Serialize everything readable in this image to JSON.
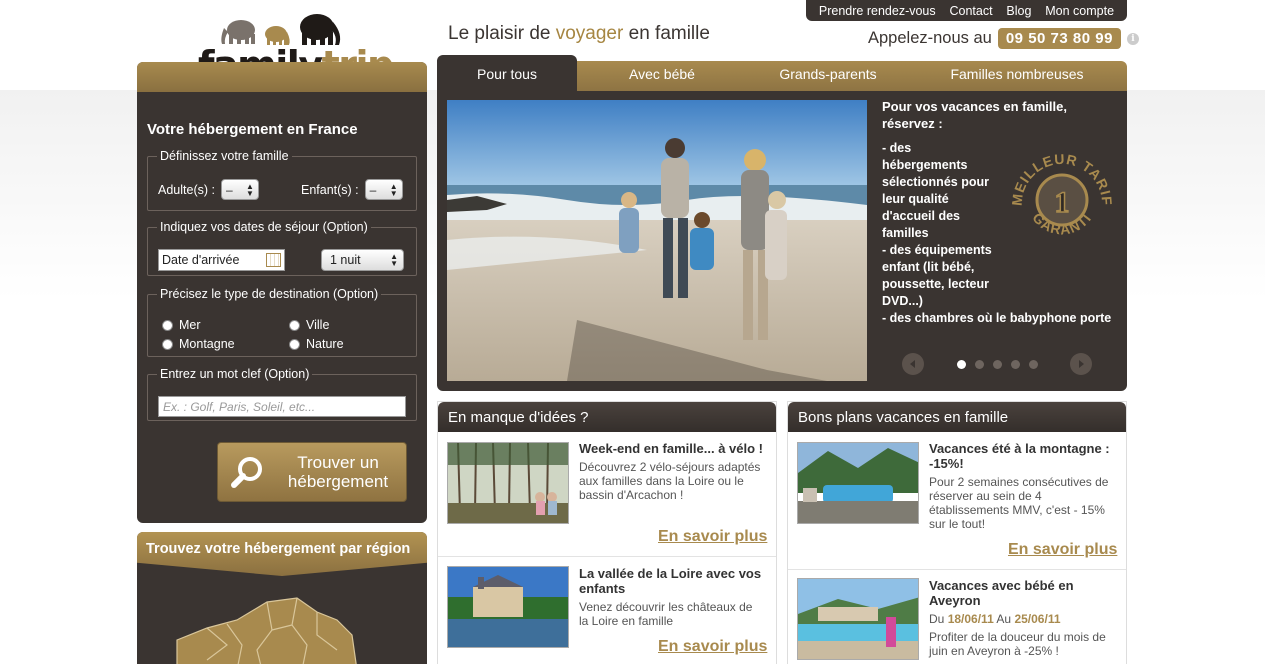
{
  "topnav": [
    "Prendre rendez-vous",
    "Contact",
    "Blog",
    "Mon compte"
  ],
  "logo": {
    "part1": "family",
    "part2": "trip"
  },
  "tagline": {
    "pre": "Le plaisir de ",
    "highlight": "voyager",
    "post": " en famille"
  },
  "phone": {
    "label": "Appelez-nous au",
    "number": "09 50 73 80 99",
    "info_icon": "info-icon"
  },
  "search": {
    "title": "Votre hébergement en France",
    "family_legend": "Définissez votre famille",
    "adults_label": "Adulte(s) :",
    "adults_value": "–",
    "children_label": "Enfant(s) :",
    "children_value": "–",
    "dates_legend": "Indiquez vos dates de séjour (Option)",
    "arrival_placeholder": "Date d'arrivée",
    "nights_value": "1 nuit",
    "type_legend": "Précisez le type de destination (Option)",
    "types": [
      "Mer",
      "Ville",
      "Montagne",
      "Nature"
    ],
    "keyword_legend": "Entrez un mot clef (Option)",
    "keyword_placeholder": "Ex. : Golf, Paris, Soleil, etc...",
    "button_line1": "Trouver un",
    "button_line2": "hébergement"
  },
  "region": {
    "title": "Trouvez votre hébergement par région"
  },
  "tabs": [
    "Pour tous",
    "Avec bébé",
    "Grands-parents",
    "Familles nombreuses"
  ],
  "slider": {
    "heading": "Pour vos vacances en famille, réservez :",
    "bullets": [
      "- des hébergements sélectionnés pour leur qualité d'accueil des familles",
      "- des équipements enfant (lit bébé, poussette, lecteur DVD...)",
      "- des chambres où le babyphone porte"
    ],
    "badge_top": "MEILLEUR TARIF",
    "badge_num": "1",
    "badge_bottom": "GARANTI",
    "dots": 5,
    "active_dot": 0
  },
  "ideas": {
    "title": "En manque d'idées ?",
    "items": [
      {
        "title": "Week-end en famille... à vélo !",
        "desc": "Découvrez 2 vélo-séjours adaptés aux familles dans la Loire ou le bassin d'Arcachon !",
        "more": "En savoir plus"
      },
      {
        "title": "La vallée de la Loire avec vos enfants",
        "desc": "Venez découvrir les châteaux de la Loire en famille",
        "more": "En savoir plus"
      }
    ]
  },
  "deals": {
    "title": "Bons plans vacances en famille",
    "items": [
      {
        "title": "Vacances été à la montagne : -15%!",
        "desc": "Pour 2 semaines consécutives de réserver au sein de 4 établissements MMV, c'est - 15% sur le tout!",
        "more": "En savoir plus"
      },
      {
        "title": "Vacances avec bébé en Aveyron",
        "du": "Du",
        "from": "18/06/11",
        "au": "Au",
        "to": "25/06/11",
        "desc": "Profiter de la douceur du mois de juin en Aveyron à -25% !"
      }
    ]
  },
  "colors": {
    "brand_gold": "#a88a4e",
    "panel_dark": "#3a3431"
  }
}
